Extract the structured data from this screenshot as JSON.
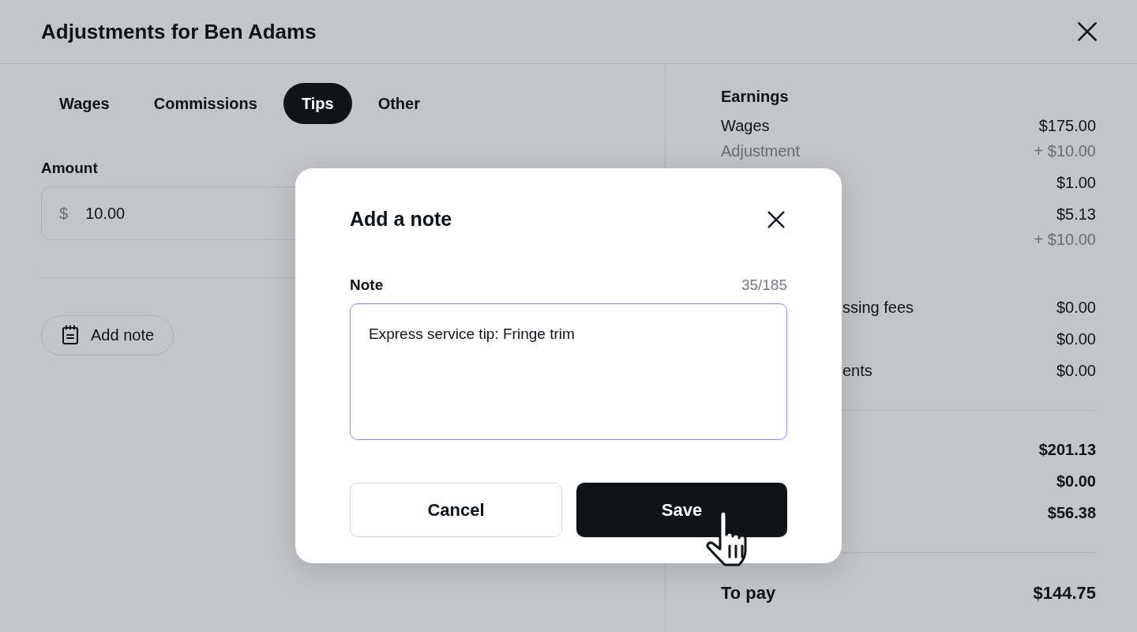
{
  "header": {
    "title": "Adjustments for Ben Adams"
  },
  "tabs": [
    {
      "label": "Wages",
      "selected": false
    },
    {
      "label": "Commissions",
      "selected": false
    },
    {
      "label": "Tips",
      "selected": true
    },
    {
      "label": "Other",
      "selected": false
    }
  ],
  "amount": {
    "label": "Amount",
    "currency": "$",
    "value": "10.00"
  },
  "add_note_button": {
    "label": "Add note"
  },
  "summary": {
    "heading": "Earnings",
    "groups": [
      {
        "rows": [
          {
            "kind": "plain",
            "label": "Wages",
            "value": "$175.00"
          },
          {
            "kind": "muted",
            "label": "Adjustment",
            "value": "+ $10.00"
          },
          {
            "kind": "plain",
            "value": "$1.00"
          },
          {
            "kind": "plain",
            "value": "$5.13"
          },
          {
            "kind": "muted",
            "value": "+ $10.00"
          }
        ]
      },
      {
        "rows": [
          {
            "kind": "plain",
            "label_tail": "ssing fees",
            "value": "$0.00"
          },
          {
            "kind": "plain",
            "value": "$0.00"
          },
          {
            "kind": "plain",
            "label_tail": "ents",
            "value": "$0.00"
          }
        ]
      },
      {
        "rows": [
          {
            "kind": "bold",
            "value": "$201.13"
          },
          {
            "kind": "bold",
            "value": "$0.00"
          },
          {
            "kind": "bold",
            "value": "$56.38"
          }
        ]
      }
    ],
    "total": {
      "label": "To pay",
      "value": "$144.75"
    }
  },
  "dialog": {
    "title": "Add a note",
    "field_label": "Note",
    "counter": "35/185",
    "value": "Express service tip: Fringe trim",
    "buttons": [
      {
        "label": "Cancel",
        "kind": "secondary"
      },
      {
        "label": "Save",
        "kind": "primary"
      }
    ]
  }
}
